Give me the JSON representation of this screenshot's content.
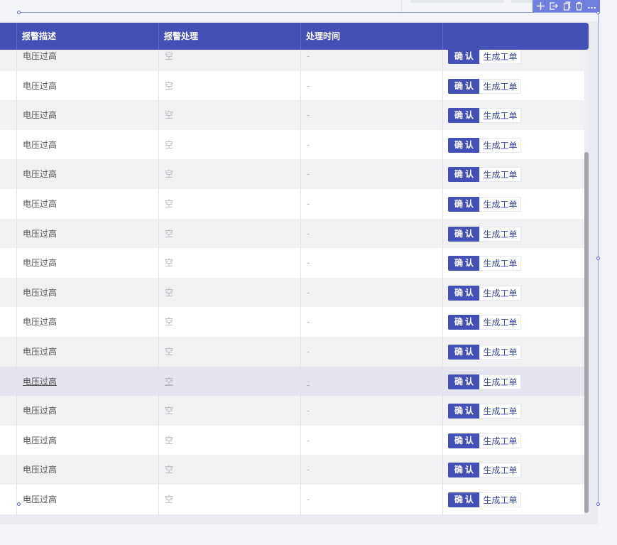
{
  "toolbar": {
    "icons": [
      "plus-icon",
      "export-icon",
      "copy-icon",
      "delete-icon",
      "more-icon"
    ],
    "more_label": "..."
  },
  "table": {
    "headers": {
      "description": "报警描述",
      "handling": "报警处理",
      "time": "处理时间",
      "actions": ""
    },
    "rows": [
      {
        "description": "电压过高",
        "handling": "空",
        "time": "-",
        "confirm": "确认",
        "order": "生成工单",
        "style": "alt"
      },
      {
        "description": "电压过高",
        "handling": "空",
        "time": "-",
        "confirm": "确认",
        "order": "生成工单",
        "style": "white"
      },
      {
        "description": "电压过高",
        "handling": "空",
        "time": "-",
        "confirm": "确认",
        "order": "生成工单",
        "style": "alt"
      },
      {
        "description": "电压过高",
        "handling": "空",
        "time": "-",
        "confirm": "确认",
        "order": "生成工单",
        "style": "white"
      },
      {
        "description": "电压过高",
        "handling": "空",
        "time": "-",
        "confirm": "确认",
        "order": "生成工单",
        "style": "alt"
      },
      {
        "description": "电压过高",
        "handling": "空",
        "time": "-",
        "confirm": "确认",
        "order": "生成工单",
        "style": "white"
      },
      {
        "description": "电压过高",
        "handling": "空",
        "time": "-",
        "confirm": "确认",
        "order": "生成工单",
        "style": "alt"
      },
      {
        "description": "电压过高",
        "handling": "空",
        "time": "-",
        "confirm": "确认",
        "order": "生成工单",
        "style": "white"
      },
      {
        "description": "电压过高",
        "handling": "空",
        "time": "-",
        "confirm": "确认",
        "order": "生成工单",
        "style": "alt"
      },
      {
        "description": "电压过高",
        "handling": "空",
        "time": "-",
        "confirm": "确认",
        "order": "生成工单",
        "style": "white"
      },
      {
        "description": "电压过高",
        "handling": "空",
        "time": "-",
        "confirm": "确认",
        "order": "生成工单",
        "style": "alt"
      },
      {
        "description": "电压过高",
        "handling": "空",
        "time": "-",
        "confirm": "确认",
        "order": "生成工单",
        "style": "hl"
      },
      {
        "description": "电压过高",
        "handling": "空",
        "time": "-",
        "confirm": "确认",
        "order": "生成工单",
        "style": "alt"
      },
      {
        "description": "电压过高",
        "handling": "空",
        "time": "-",
        "confirm": "确认",
        "order": "生成工单",
        "style": "white"
      },
      {
        "description": "电压过高",
        "handling": "空",
        "time": "-",
        "confirm": "确认",
        "order": "生成工单",
        "style": "alt"
      },
      {
        "description": "电压过高",
        "handling": "空",
        "time": "-",
        "confirm": "确认",
        "order": "生成工单",
        "style": "white"
      }
    ]
  },
  "colors": {
    "header_bg": "#4350b6",
    "accent_button": "#4350b6",
    "selection_outline": "#8f9ae6",
    "toolbar_bg": "#6f7fe0"
  }
}
